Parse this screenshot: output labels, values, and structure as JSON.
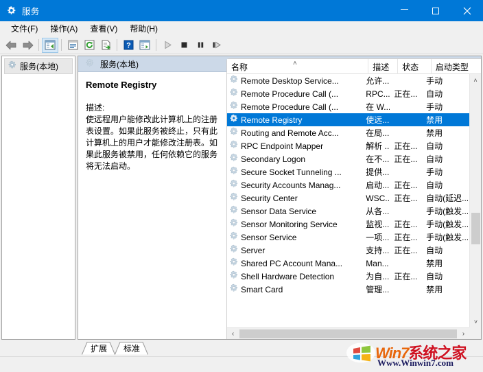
{
  "window": {
    "title": "服务",
    "icon": "services-gear-icon",
    "accent": "#0078d7",
    "minimize_label": "─",
    "maximize_label": "□",
    "close_label": "✕"
  },
  "menu": {
    "items": [
      {
        "label": "文件(F)",
        "name": "menu-file"
      },
      {
        "label": "操作(A)",
        "name": "menu-action"
      },
      {
        "label": "查看(V)",
        "name": "menu-view"
      },
      {
        "label": "帮助(H)",
        "name": "menu-help"
      }
    ]
  },
  "toolbar": {
    "buttons": [
      {
        "name": "back-arrow-icon",
        "tip": "后退"
      },
      {
        "name": "forward-arrow-icon",
        "tip": "前进"
      },
      {
        "name": "show-hide-tree-icon",
        "tip": "显示/隐藏控制台树",
        "active": true
      },
      {
        "name": "properties-icon",
        "tip": "属性"
      },
      {
        "name": "refresh-icon",
        "tip": "刷新"
      },
      {
        "name": "export-list-icon",
        "tip": "导出列表"
      },
      {
        "name": "help-icon",
        "tip": "帮助"
      },
      {
        "name": "new-window-icon",
        "tip": "新建窗口"
      },
      {
        "name": "start-service-icon",
        "tip": "启动服务"
      },
      {
        "name": "stop-service-icon",
        "tip": "停止服务"
      },
      {
        "name": "pause-service-icon",
        "tip": "暂停服务"
      },
      {
        "name": "restart-service-icon",
        "tip": "重启服务"
      }
    ]
  },
  "tree": {
    "root_label": "服务(本地)",
    "root_icon": "services-gear-icon"
  },
  "pane": {
    "header_label": "服务(本地)",
    "header_icon": "services-gear-icon"
  },
  "detail": {
    "service_name": "Remote Registry",
    "description_label": "描述:",
    "description_text": "使远程用户能修改此计算机上的注册表设置。如果此服务被终止，只有此计算机上的用户才能修改注册表。如果此服务被禁用，任何依赖它的服务将无法启动。"
  },
  "list": {
    "columns": [
      {
        "key": "name",
        "label": "名称",
        "sorted": true,
        "sort_glyph": "˄"
      },
      {
        "key": "desc",
        "label": "描述"
      },
      {
        "key": "status",
        "label": "状态"
      },
      {
        "key": "start",
        "label": "启动类型"
      }
    ],
    "rows": [
      {
        "name": "Remote Desktop Service...",
        "desc": "允许...",
        "status": "",
        "start": "手动",
        "selected": false
      },
      {
        "name": "Remote Procedure Call (...",
        "desc": "RPC...",
        "status": "正在...",
        "start": "自动",
        "selected": false
      },
      {
        "name": "Remote Procedure Call (...",
        "desc": "在 W...",
        "status": "",
        "start": "手动",
        "selected": false
      },
      {
        "name": "Remote Registry",
        "desc": "使远...",
        "status": "",
        "start": "禁用",
        "selected": true
      },
      {
        "name": "Routing and Remote Acc...",
        "desc": "在局...",
        "status": "",
        "start": "禁用",
        "selected": false
      },
      {
        "name": "RPC Endpoint Mapper",
        "desc": "解析 ...",
        "status": "正在...",
        "start": "自动",
        "selected": false
      },
      {
        "name": "Secondary Logon",
        "desc": "在不...",
        "status": "正在...",
        "start": "自动",
        "selected": false
      },
      {
        "name": "Secure Socket Tunneling ...",
        "desc": "提供...",
        "status": "",
        "start": "手动",
        "selected": false
      },
      {
        "name": "Security Accounts Manag...",
        "desc": "启动...",
        "status": "正在...",
        "start": "自动",
        "selected": false
      },
      {
        "name": "Security Center",
        "desc": "WSC...",
        "status": "正在...",
        "start": "自动(延迟...",
        "selected": false
      },
      {
        "name": "Sensor Data Service",
        "desc": "从各...",
        "status": "",
        "start": "手动(触发...",
        "selected": false
      },
      {
        "name": "Sensor Monitoring Service",
        "desc": "监视...",
        "status": "正在...",
        "start": "手动(触发...",
        "selected": false
      },
      {
        "name": "Sensor Service",
        "desc": "一项...",
        "status": "正在...",
        "start": "手动(触发...",
        "selected": false
      },
      {
        "name": "Server",
        "desc": "支持...",
        "status": "正在...",
        "start": "自动",
        "selected": false
      },
      {
        "name": "Shared PC Account Mana...",
        "desc": "Man...",
        "status": "",
        "start": "禁用",
        "selected": false
      },
      {
        "name": "Shell Hardware Detection",
        "desc": "为自...",
        "status": "正在...",
        "start": "自动",
        "selected": false
      },
      {
        "name": "Smart Card",
        "desc": "管理...",
        "status": "",
        "start": "禁用",
        "selected": false
      }
    ],
    "row_icon": "service-gear-icon",
    "selection_color": "#0078d7",
    "scroll_up_glyph": "˄",
    "scroll_down_glyph": "˅",
    "scroll_left_glyph": "‹",
    "scroll_right_glyph": "›"
  },
  "tabs": [
    {
      "label": "扩展",
      "name": "tab-extended",
      "active": false
    },
    {
      "label": "标准",
      "name": "tab-standard",
      "active": true
    }
  ],
  "watermark": {
    "brand_win": "W",
    "brand_in": "in",
    "brand_7": "7",
    "brand_cn": "系统之家",
    "url": "Www.Winwin7.com"
  }
}
